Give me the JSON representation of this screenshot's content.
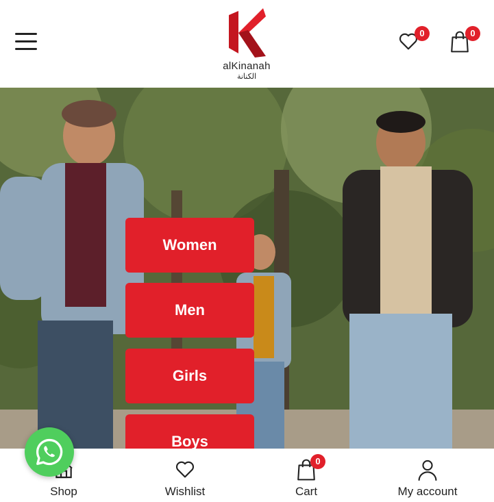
{
  "header": {
    "logo_text": "alKinanah",
    "logo_arabic": "الكنانة",
    "wishlist_count": "0",
    "cart_count": "0"
  },
  "categories": [
    {
      "label": "Women"
    },
    {
      "label": "Men"
    },
    {
      "label": "Girls"
    },
    {
      "label": "Boys"
    }
  ],
  "bottom_nav": {
    "shop": "Shop",
    "wishlist": "Wishlist",
    "cart": "Cart",
    "cart_count": "0",
    "account": "My account"
  },
  "colors": {
    "accent": "#e1202a",
    "whatsapp": "#4fce5d"
  }
}
